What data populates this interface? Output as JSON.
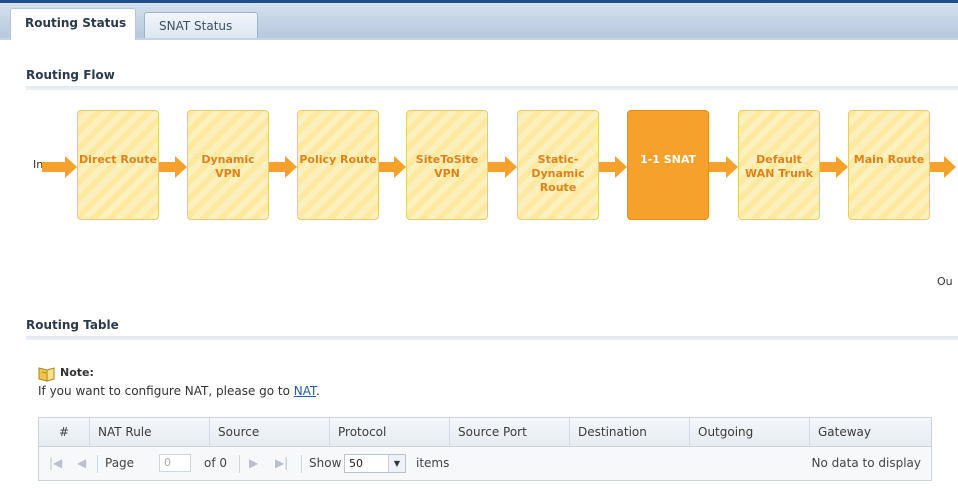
{
  "tabs": [
    {
      "label": "Routing Status",
      "active": true
    },
    {
      "label": "SNAT Status",
      "active": false
    }
  ],
  "routing_flow": {
    "title": "Routing Flow",
    "in_label": "In",
    "out_label": "Ou",
    "steps": [
      {
        "label": "Direct Route",
        "selected": false
      },
      {
        "label": "Dynamic\nVPN",
        "selected": false
      },
      {
        "label": "Policy Route",
        "selected": false
      },
      {
        "label": "SiteToSite\nVPN",
        "selected": false
      },
      {
        "label": "Static-\nDynamic\nRoute",
        "selected": false
      },
      {
        "label": "1-1 SNAT",
        "selected": true
      },
      {
        "label": "Default\nWAN Trunk",
        "selected": false
      },
      {
        "label": "Main Route",
        "selected": false
      }
    ]
  },
  "routing_table": {
    "title": "Routing Table",
    "note_title": "Note:",
    "note_text": "If you want to configure NAT, please go to ",
    "note_link": "NAT",
    "note_end": ".",
    "columns": [
      "#",
      "NAT Rule",
      "Source",
      "Protocol",
      "Source Port",
      "Destination",
      "Outgoing",
      "Gateway"
    ],
    "rows": [],
    "pager": {
      "first_icon": "first-page-icon",
      "prev_icon": "prev-page-icon",
      "page_label": "Page",
      "page_value": "0",
      "of_label": "of 0",
      "next_icon": "next-page-icon",
      "last_icon": "last-page-icon",
      "show_label": "Show",
      "show_value": "50",
      "items_label": "items",
      "empty_text": "No data to display"
    }
  },
  "colors": {
    "accent": "#f5a12b",
    "box_text": "#e0821a",
    "header_blue": "#1e4f8c"
  }
}
